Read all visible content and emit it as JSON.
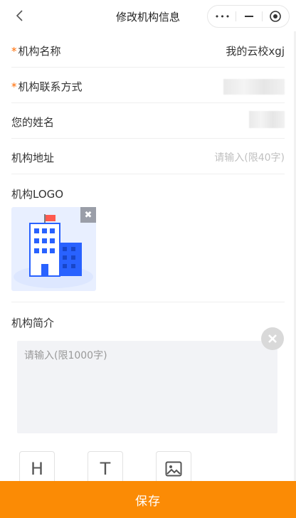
{
  "nav": {
    "title": "修改机构信息",
    "more_dots": "•••"
  },
  "form": {
    "name_label": "机构名称",
    "name_value": "我的云校xgj",
    "contact_label": "机构联系方式",
    "your_name_label": "您的姓名",
    "address_label": "机构地址",
    "address_placeholder": "请输入(限40字)",
    "required_mark": "*"
  },
  "logo": {
    "label": "机构LOGO",
    "delete_glyph": "✖"
  },
  "intro": {
    "label": "机构简介",
    "placeholder": "请输入(限1000字)"
  },
  "toolbar": {
    "heading_glyph": "H",
    "text_glyph": "T"
  },
  "footer": {
    "save_label": "保存"
  },
  "colors": {
    "accent": "#fb8b05",
    "required": "#ff6a00",
    "logo_blue": "#2962ff"
  }
}
